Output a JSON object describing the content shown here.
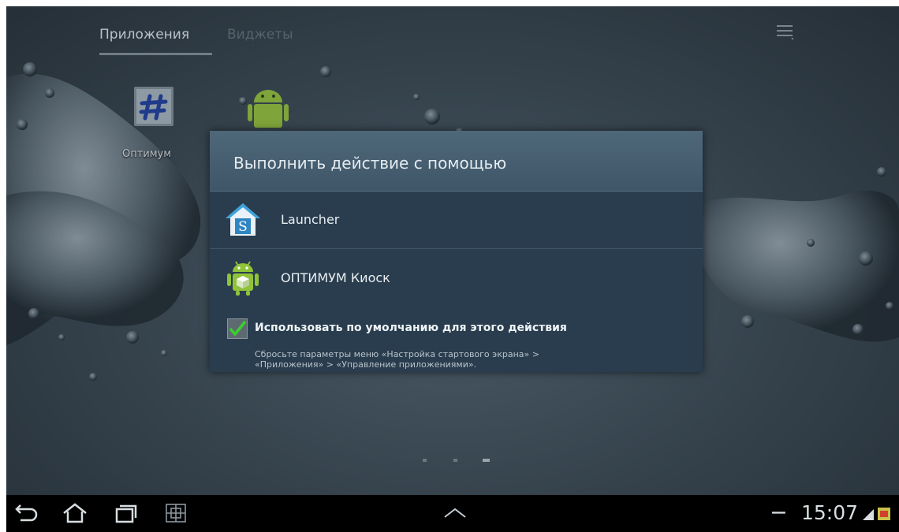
{
  "tabs": {
    "apps": "Приложения",
    "widgets": "Виджеты"
  },
  "apps": [
    {
      "label": "Оптимум",
      "icon": "optimum-hash-icon"
    },
    {
      "label": "",
      "icon": "android-robot-icon"
    }
  ],
  "dialog": {
    "title": "Выполнить действие с помощью",
    "options": [
      {
        "label": "Launcher",
        "icon": "launcher-house-s-icon"
      },
      {
        "label": "ОПТИМУМ Киоск",
        "icon": "android-kiosk-icon"
      }
    ],
    "use_default_label": "Использовать по умолчанию для этого действия",
    "use_default_checked": true,
    "hint_line1": "Сбросьте параметры меню «Настройка стартового экрана» >",
    "hint_line2": "«Приложения» > «Управление приложениями»."
  },
  "page_indicator": {
    "pages": 3,
    "current": 3
  },
  "statusbar": {
    "time": "15:07",
    "icons": [
      "signal-icon",
      "notification-icon"
    ]
  },
  "navbar": {
    "buttons": [
      "back-icon",
      "home-icon",
      "recent-apps-icon",
      "screenshot-icon",
      "up-arrow-icon"
    ]
  },
  "colors": {
    "accent_check": "#39d12b",
    "dialog_bg": "#2a3d4e",
    "header_bg": "#4a6374"
  }
}
